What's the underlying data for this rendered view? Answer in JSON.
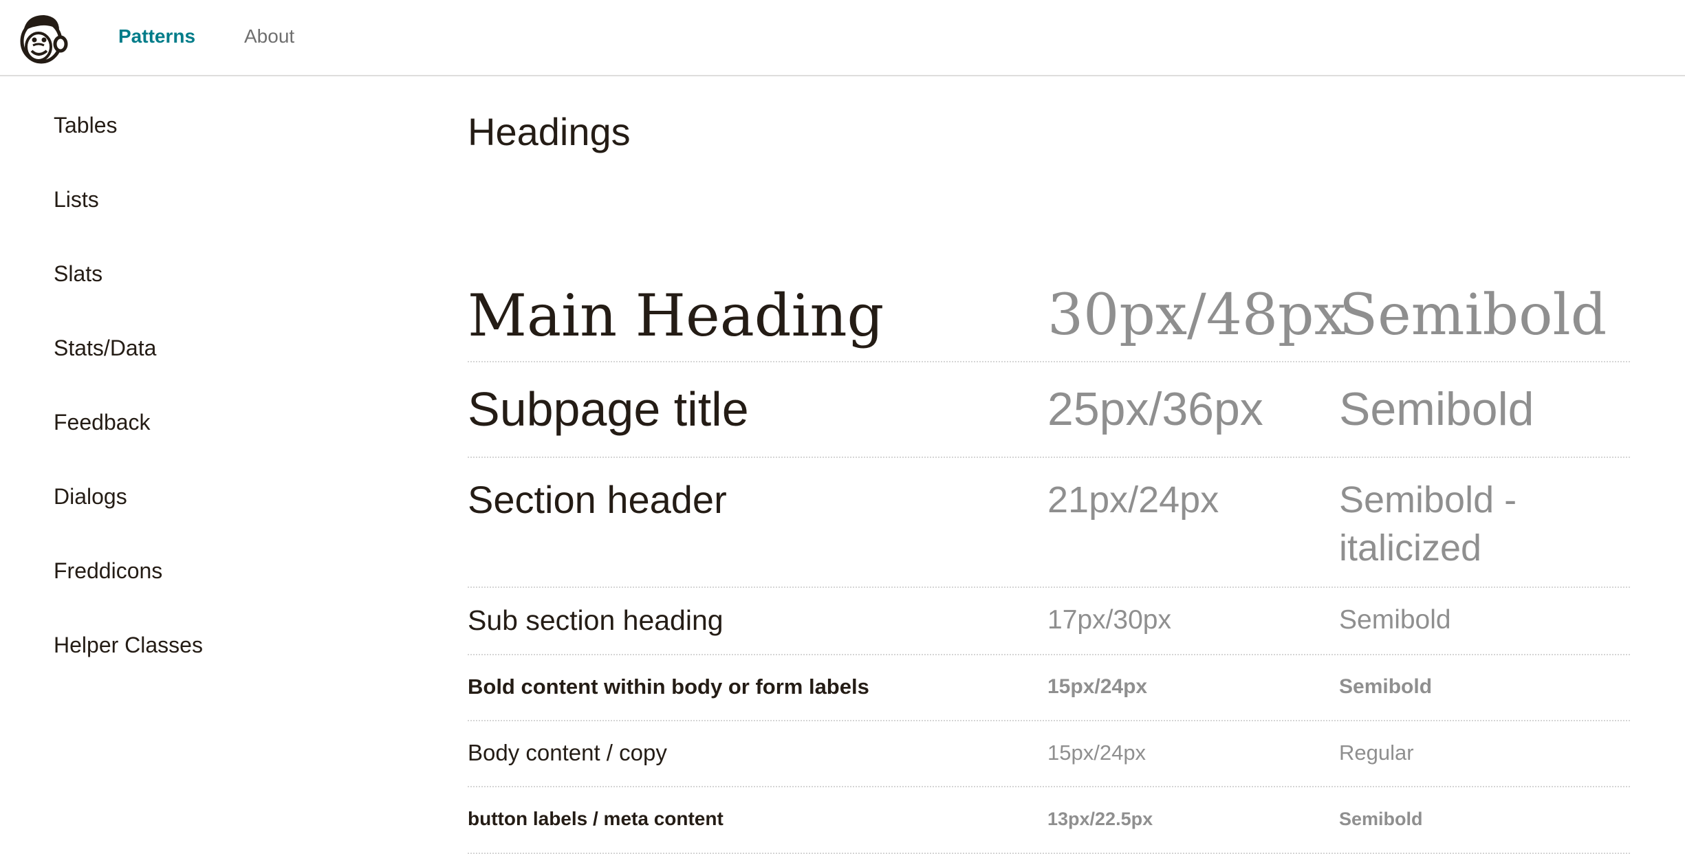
{
  "nav": {
    "links": [
      {
        "label": "Patterns",
        "active": true
      },
      {
        "label": "About",
        "active": false
      }
    ],
    "active_color": "#007c89"
  },
  "sidebar": {
    "items": [
      {
        "label": "Tables"
      },
      {
        "label": "Lists"
      },
      {
        "label": "Slats"
      },
      {
        "label": "Stats/Data"
      },
      {
        "label": "Feedback"
      },
      {
        "label": "Dialogs"
      },
      {
        "label": "Freddicons"
      },
      {
        "label": "Helper Classes"
      }
    ]
  },
  "main": {
    "title": "Headings",
    "rows": [
      {
        "name": "Main Heading",
        "size": "30px/48px",
        "weight": "Semibold"
      },
      {
        "name": "Subpage title",
        "size": "25px/36px",
        "weight": "Semibold"
      },
      {
        "name": "Section header",
        "size": "21px/24px",
        "weight": "Semibold -\nitalicized"
      },
      {
        "name": "Sub section heading",
        "size": "17px/30px",
        "weight": "Semibold"
      },
      {
        "name": "Bold content within body or form labels",
        "size": "15px/24px",
        "weight": "Semibold"
      },
      {
        "name": "Body content / copy",
        "size": "15px/24px",
        "weight": "Regular"
      },
      {
        "name": "button labels / meta content",
        "size": "13px/22.5px",
        "weight": "Semibold"
      }
    ]
  },
  "colors": {
    "text": "#241c15",
    "muted": "#8f8f8f",
    "divider": "#d5d5d5"
  },
  "icons": {
    "logo": "freddie-logo-icon"
  }
}
